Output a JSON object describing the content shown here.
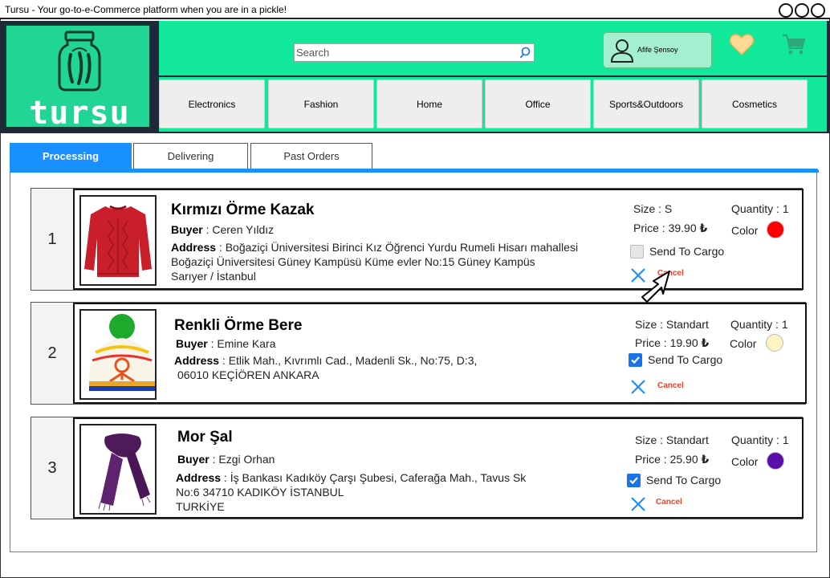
{
  "window": {
    "title": "Tursu - Your go-to-e-Commerce platform when you are in a pickle!"
  },
  "header": {
    "logo_text": "tursu",
    "search": {
      "placeholder": "Search"
    },
    "user": {
      "name": "Afife Şensoy"
    }
  },
  "nav": [
    "Electronics",
    "Fashion",
    "Home",
    "Office",
    "Sports&Outdoors",
    "Cosmetics"
  ],
  "tabs": [
    {
      "label": "Processing",
      "active": true
    },
    {
      "label": "Delivering",
      "active": false
    },
    {
      "label": "Past Orders",
      "active": false
    }
  ],
  "labels": {
    "buyer": "Buyer",
    "address": "Address",
    "size": "Size",
    "price": "Price",
    "quantity": "Quantity",
    "color": "Color",
    "send_to_cargo": "Send To Cargo",
    "cancel": "Cancel",
    "currency": "₺"
  },
  "orders": [
    {
      "index": "1",
      "name": "Kırmızı Örme Kazak",
      "buyer": "Ceren Yıldız",
      "address_lines": [
        "Boğaziçi Üniversitesi Birinci Kız Öğrenci Yurdu Rumeli Hisarı mahallesi",
        "Boğaziçi Üniversitesi Güney Kampüsü Küme evler No:15 Güney Kampüs",
        "Sarıyer / İstanbul"
      ],
      "size": "S",
      "quantity": "1",
      "price": "39.90",
      "color": "#ff0000",
      "send_to_cargo": false
    },
    {
      "index": "2",
      "name": "Renkli Örme Bere",
      "buyer": "Emine Kara",
      "address_lines": [
        "Etlik Mah., Kıvrımlı Cad., Madenli Sk., No:75, D:3,",
        "06010 KEÇİÖREN ANKARA"
      ],
      "size": "Standart",
      "quantity": "1",
      "price": "19.90",
      "color": "#fff3c2",
      "send_to_cargo": true
    },
    {
      "index": "3",
      "name": "Mor Şal",
      "buyer": "Ezgi Orhan",
      "address_lines": [
        "İş Bankası Kadıköy Çarşı Şubesi, Caferağa Mah., Tavus Sk",
        "No:6 34710 KADIKÖY İSTANBUL",
        "TURKİYE"
      ],
      "size": "Standart",
      "quantity": "1",
      "price": "25.90",
      "color": "#5b0fa8",
      "send_to_cargo": true
    }
  ],
  "colors": {
    "brand_green": "#12e89a",
    "logo_green": "#21d595",
    "accent_blue": "#1890ff",
    "cancel_red": "#e8452c"
  }
}
